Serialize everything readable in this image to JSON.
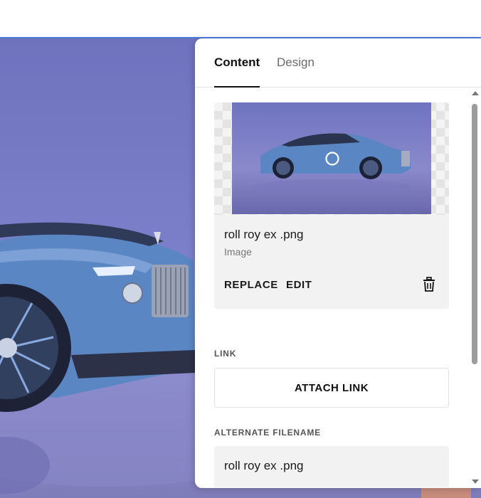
{
  "panel": {
    "tabs": [
      {
        "label": "Content",
        "active": true
      },
      {
        "label": "Design",
        "active": false
      }
    ],
    "image": {
      "name": "roll roy ex .png",
      "type": "Image",
      "replace_label": "REPLACE",
      "edit_label": "EDIT",
      "delete_icon": "trash-icon"
    },
    "link": {
      "section_label": "LINK",
      "button_label": "ATTACH LINK"
    },
    "alternate_filename": {
      "section_label": "ALTERNATE FILENAME",
      "value": "roll roy ex .png"
    }
  },
  "colors": {
    "accent_line": "#4a7bd6",
    "photo_background": "#7b7fc9",
    "car_body": "#5b86c4"
  }
}
